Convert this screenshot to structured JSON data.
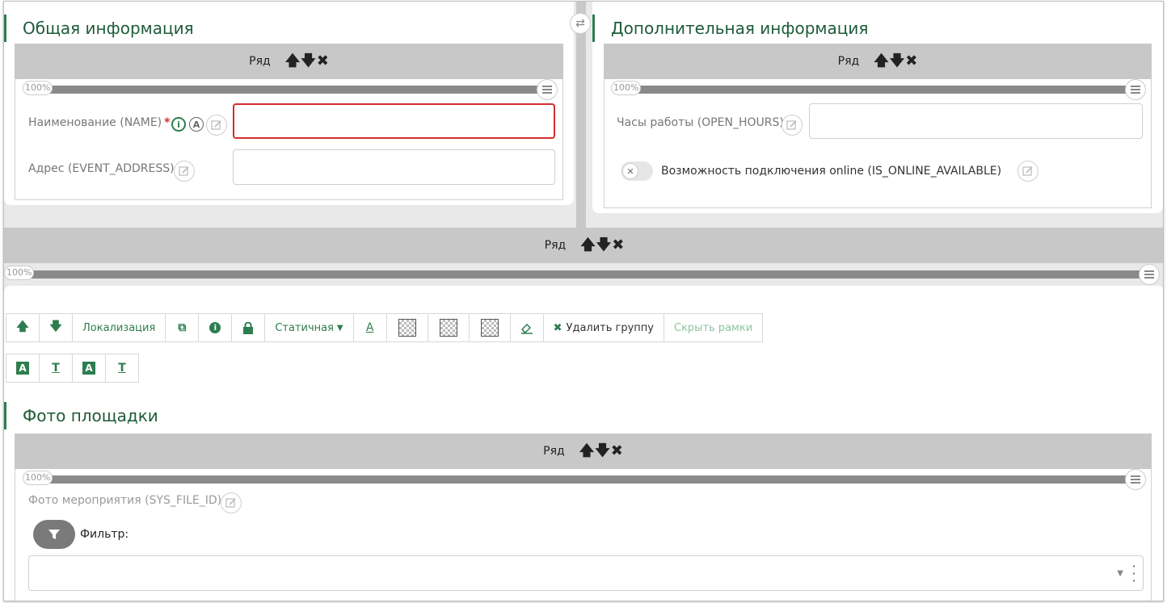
{
  "left_card": {
    "title": "Общая информация",
    "row_label": "Ряд",
    "progress": "100%",
    "fields": {
      "name_label": "Наименование (NAME)",
      "name_required": "*",
      "address_label": "Адрес (EVENT_ADDRESS)"
    }
  },
  "right_card": {
    "title": "Дополнительная информация",
    "row_label": "Ряд",
    "progress": "100%",
    "fields": {
      "hours_label": "Часы работы (OPEN_HOURS)",
      "online_label": "Возможность подключения online (IS_ONLINE_AVAILABLE)"
    }
  },
  "middle_row": {
    "row_label": "Ряд",
    "progress": "100%"
  },
  "toolbar": {
    "localization": "Локализация",
    "static_select": "Статичная",
    "delete_group": "Удалить группу",
    "hide_frames": "Скрыть рамки"
  },
  "photo_card": {
    "title": "Фото площадки",
    "row_label": "Ряд",
    "progress": "100%",
    "file_label": "Фото мероприятия (SYS_FILE_ID)",
    "filter_label": "Фильтр:"
  },
  "icons": {
    "row_controls": [
      "arrow-up-icon",
      "arrow-down-icon",
      "close-icon"
    ],
    "toggle_off": "✕"
  },
  "colors": {
    "accent": "#2e7d4f",
    "title": "#1e5b3a",
    "error": "#d32f2f",
    "row_bar": "#c8c8c8"
  }
}
